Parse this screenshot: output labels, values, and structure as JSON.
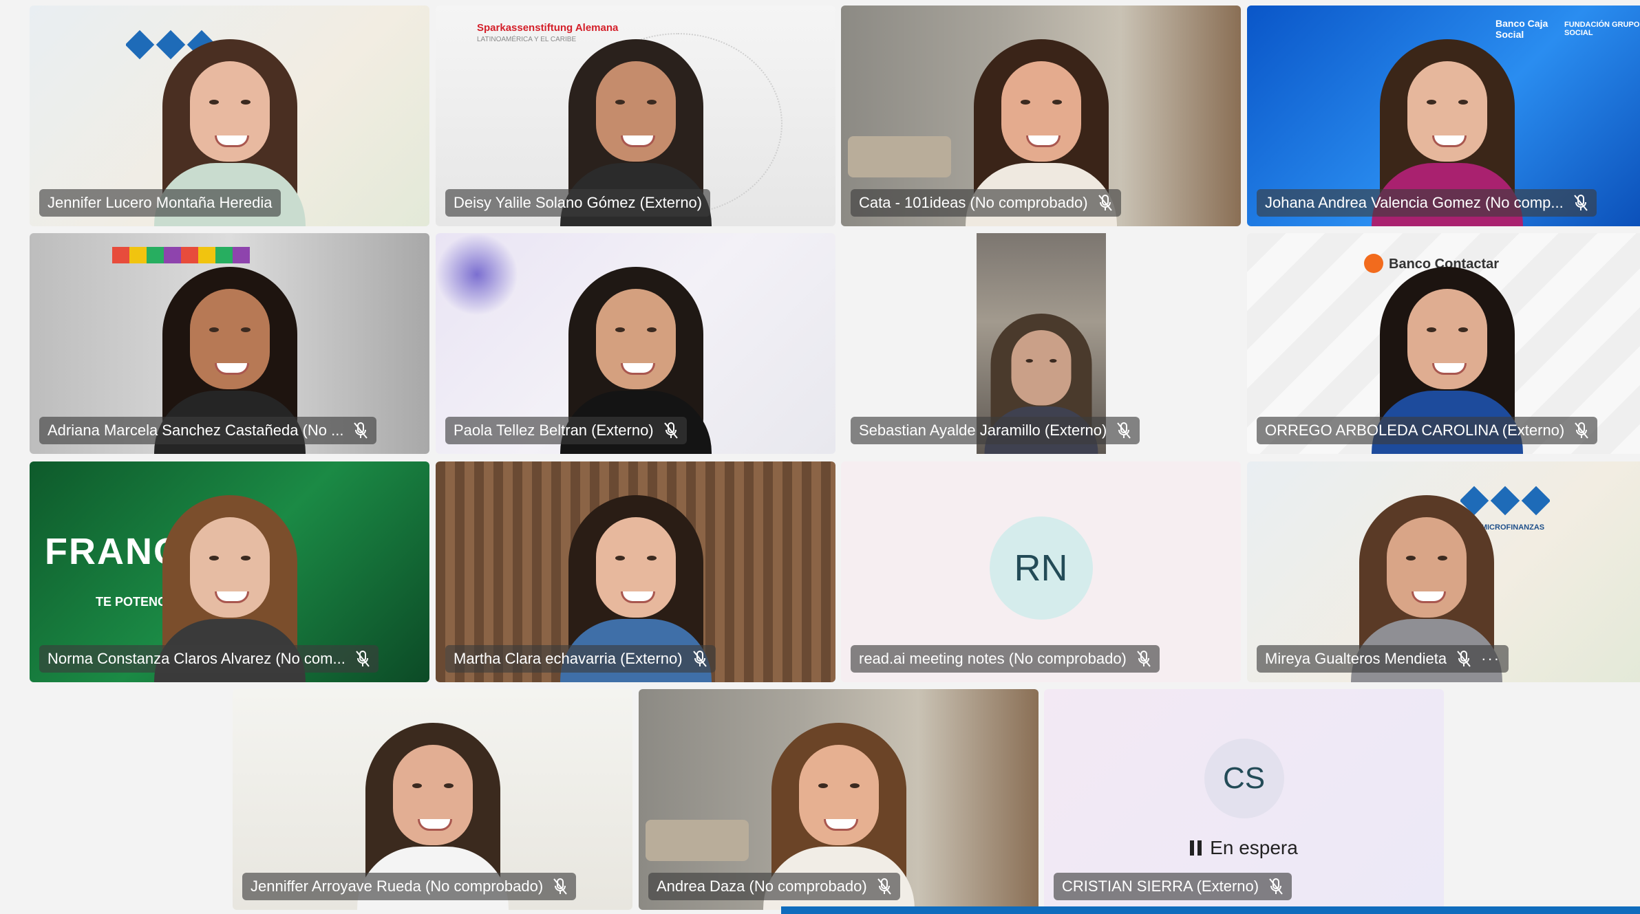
{
  "app": {
    "accent": "#0f6cbd"
  },
  "tiles": [
    {
      "name": "Jennifer Lucero Montaña Heredia",
      "muted": false
    },
    {
      "name": "Deisy Yalile Solano Gómez (Externo)",
      "muted": false
    },
    {
      "name": "Cata - 101ideas (No comprobado)",
      "muted": true
    },
    {
      "name": "Johana Andrea Valencia Gomez (No comp...",
      "muted": true
    },
    {
      "name": "Adriana Marcela Sanchez Castañeda (No ...",
      "muted": true
    },
    {
      "name": "Paola Tellez Beltran (Externo)",
      "muted": true
    },
    {
      "name": "Sebastian Ayalde Jaramillo (Externo)",
      "muted": true
    },
    {
      "name": "ORREGO ARBOLEDA CAROLINA (Externo)",
      "muted": true
    },
    {
      "name": "Norma Constanza Claros Alvarez (No com...",
      "muted": true
    },
    {
      "name": "Martha Clara echavarria (Externo)",
      "muted": true
    },
    {
      "name": "read.ai meeting notes (No comprobado)",
      "muted": true,
      "initials": "RN"
    },
    {
      "name": "Mireya Gualteros Mendieta",
      "muted": true,
      "more": "···"
    },
    {
      "name": "Jenniffer Arroyave Rueda (No comprobado)",
      "muted": true
    },
    {
      "name": "Andrea Daza (No comprobado)",
      "muted": true
    },
    {
      "name": "CRISTIAN SIERRA (Externo)",
      "muted": true,
      "initials": "CS",
      "status": "En espera"
    }
  ],
  "backgrounds": {
    "sparkasse": "Sparkassenstiftung Alemana",
    "sparkasse_sub": "LATINOAMÉRICA Y EL CARIBE",
    "banco_caja": "Banco Caja Social",
    "fundacion": "FUNDACIÓN GRUPO SOCIAL",
    "contactar": "Banco Contactar",
    "franco": "FRANCO",
    "franco_sub": "TE POTENC",
    "asomicro": "ASOMICROFINANZAS"
  }
}
